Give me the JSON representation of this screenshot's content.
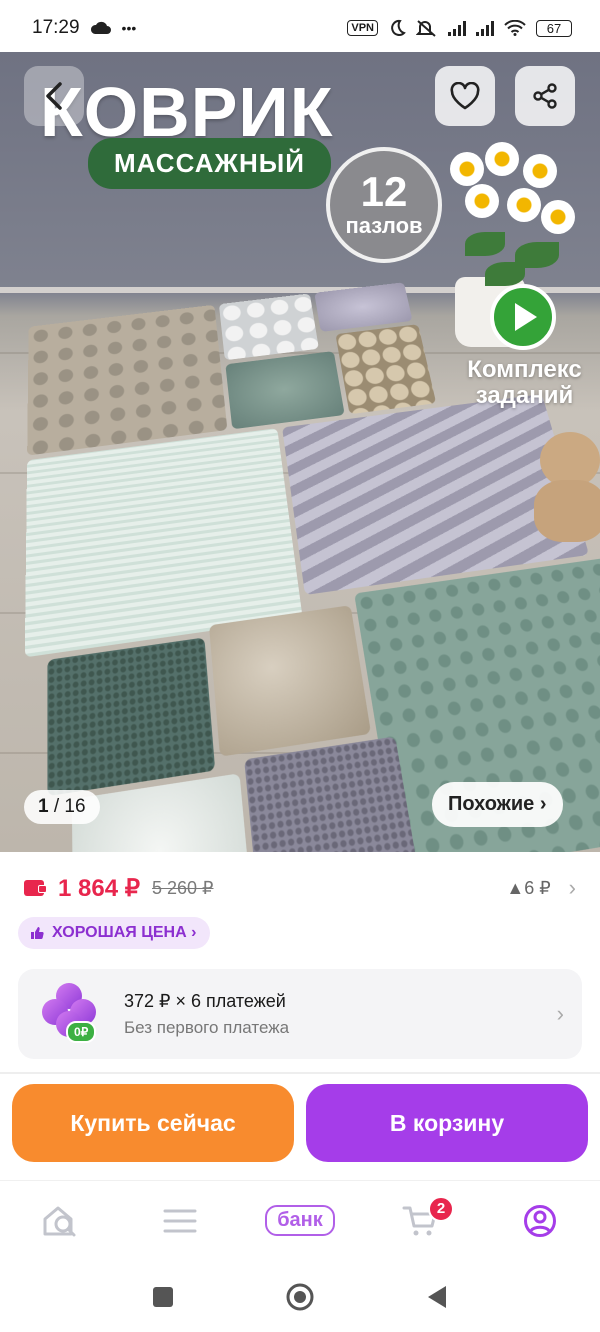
{
  "status_bar": {
    "time": "17:29",
    "extra": "•••",
    "vpn": "VPN",
    "battery": "67"
  },
  "hero": {
    "title_big": "КОВРИК",
    "title_pill": "МАССАЖНЫЙ",
    "badge_number": "12",
    "badge_text": "пазлов",
    "video_label_1": "Комплекс",
    "video_label_2": "заданий",
    "counter_current": "1",
    "counter_total": "/ 16",
    "similar_label": "Похожие ›"
  },
  "price": {
    "current": "1 864 ₽",
    "old": "5 260 ₽",
    "change": "▲6 ₽",
    "badge": "ХОРОШАЯ ЦЕНА ›"
  },
  "installment": {
    "line1": "372 ₽ × 6 платежей",
    "line2": "Без первого платежа",
    "zero_badge": "0₽"
  },
  "actions": {
    "buy_now": "Купить сейчас",
    "to_cart": "В корзину"
  },
  "bottom_nav": {
    "bank_label": "банк",
    "cart_count": "2"
  },
  "colors": {
    "price_red": "#e8264d",
    "buy_orange": "#f88b2e",
    "cart_purple": "#a53de9",
    "good_price_text": "#8c2fd0"
  },
  "icons": [
    "back-icon",
    "heart-icon",
    "share-icon",
    "play-icon",
    "wallet-icon",
    "thumb-up-icon",
    "chevron-right-icon",
    "clover-icon",
    "home-search-icon",
    "catalog-icon",
    "cart-icon",
    "profile-icon",
    "square-icon",
    "circle-icon",
    "triangle-back-icon"
  ]
}
